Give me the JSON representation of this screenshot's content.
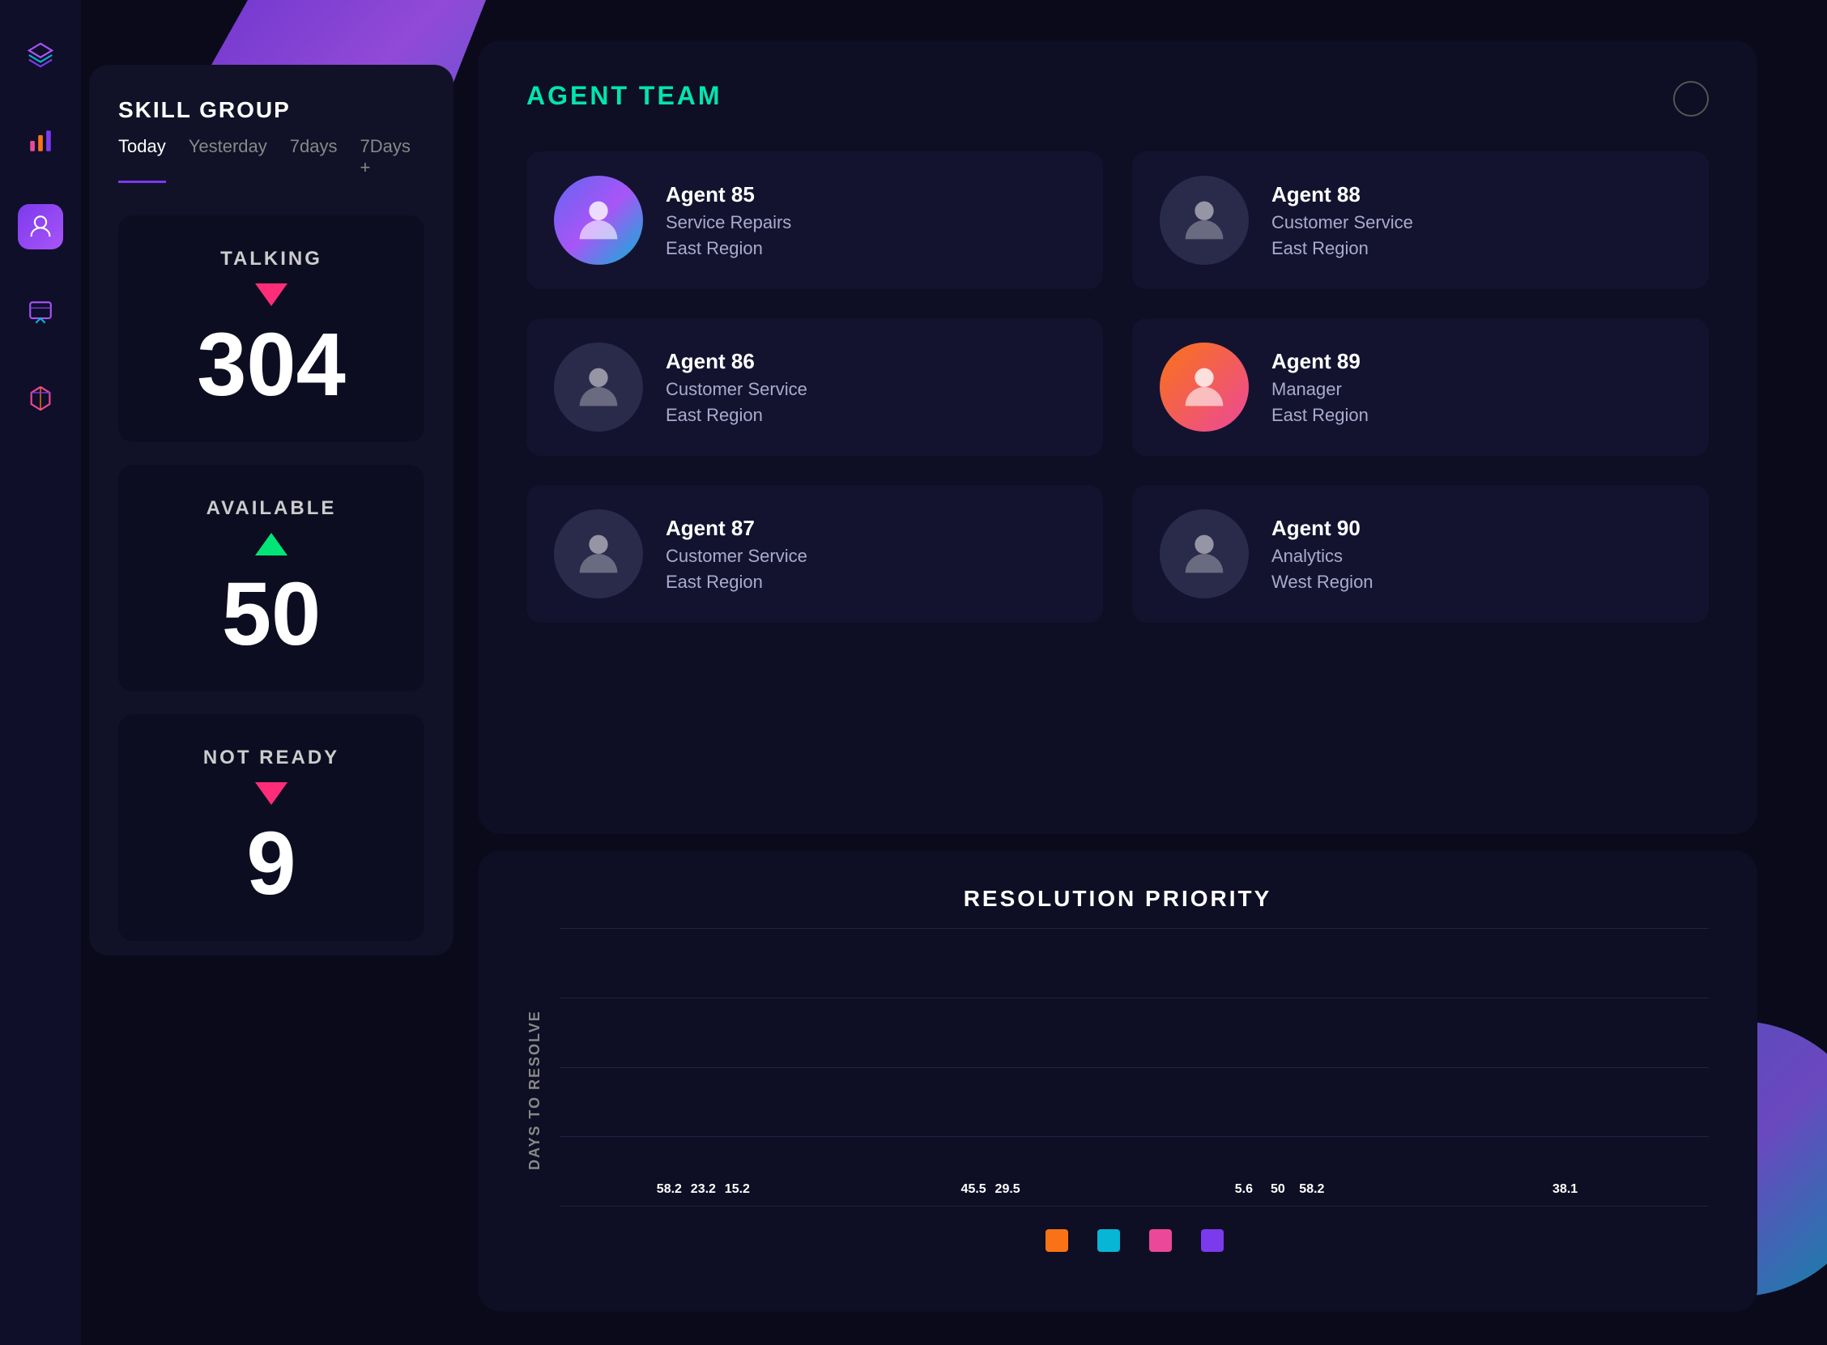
{
  "sidebar": {
    "icons": [
      {
        "name": "layers-icon",
        "label": "Layers"
      },
      {
        "name": "chart-icon",
        "label": "Chart"
      },
      {
        "name": "monitor-icon",
        "label": "Monitor",
        "active": true
      },
      {
        "name": "bookmark-icon",
        "label": "Bookmark"
      },
      {
        "name": "cube-icon",
        "label": "Cube"
      }
    ]
  },
  "skill_panel": {
    "title": "SKILL GROUP",
    "tabs": [
      {
        "label": "Today",
        "active": true
      },
      {
        "label": "Yesterday",
        "active": false
      },
      {
        "label": "7days",
        "active": false
      },
      {
        "label": "7Days +",
        "active": false
      }
    ],
    "stats": [
      {
        "label": "TALKING",
        "arrow": "down",
        "value": "304"
      },
      {
        "label": "AVAILABLE",
        "arrow": "up",
        "value": "50"
      },
      {
        "label": "NOT READY",
        "arrow": "down",
        "value": "9"
      }
    ]
  },
  "agent_panel": {
    "title": "AGENT TEAM",
    "circle_button": "○",
    "agents": [
      {
        "name": "Agent 85",
        "role": "Service Repairs",
        "region": "East Region",
        "avatar_style": "blue-purple"
      },
      {
        "name": "Agent 88",
        "role": "Customer Service",
        "region": "East Region",
        "avatar_style": "gray"
      },
      {
        "name": "Agent 86",
        "role": "Customer Service",
        "region": "East Region",
        "avatar_style": "gray"
      },
      {
        "name": "Agent 89",
        "role": "Manager",
        "region": "East Region",
        "avatar_style": "orange-pink"
      },
      {
        "name": "Agent 87",
        "role": "Customer Service",
        "region": "East Region",
        "avatar_style": "gray"
      },
      {
        "name": "Agent 90",
        "role": "Analytics",
        "region": "West Region",
        "avatar_style": "gray"
      }
    ]
  },
  "resolution_panel": {
    "title": "RESOLUTION PRIORITY",
    "y_axis_label": "DAYS TO RESOLVE",
    "bar_groups": [
      {
        "bars": [
          {
            "color": "purple",
            "value": 58.2,
            "height_pct": 82
          },
          {
            "color": "cyan",
            "value": 23.2,
            "height_pct": 33
          },
          {
            "color": "orange",
            "value": 15.2,
            "height_pct": 22
          }
        ]
      },
      {
        "bars": [
          {
            "color": "purple",
            "value": 45.5,
            "height_pct": 65
          },
          {
            "color": "cyan",
            "value": 29.5,
            "height_pct": 42
          }
        ]
      },
      {
        "bars": [
          {
            "color": "cyan",
            "value": 5.6,
            "height_pct": 8
          },
          {
            "color": "pink",
            "value": 50,
            "height_pct": 71
          },
          {
            "color": "orange",
            "value": 58.2,
            "height_pct": 82
          }
        ]
      },
      {
        "bars": [
          {
            "color": "purple",
            "value": 38.1,
            "height_pct": 54
          }
        ]
      }
    ],
    "legend": [
      {
        "color": "orange",
        "hex": "#f97316"
      },
      {
        "color": "cyan",
        "hex": "#06b6d4"
      },
      {
        "color": "pink",
        "hex": "#ec4899"
      },
      {
        "color": "purple",
        "hex": "#7c3aed"
      }
    ]
  }
}
